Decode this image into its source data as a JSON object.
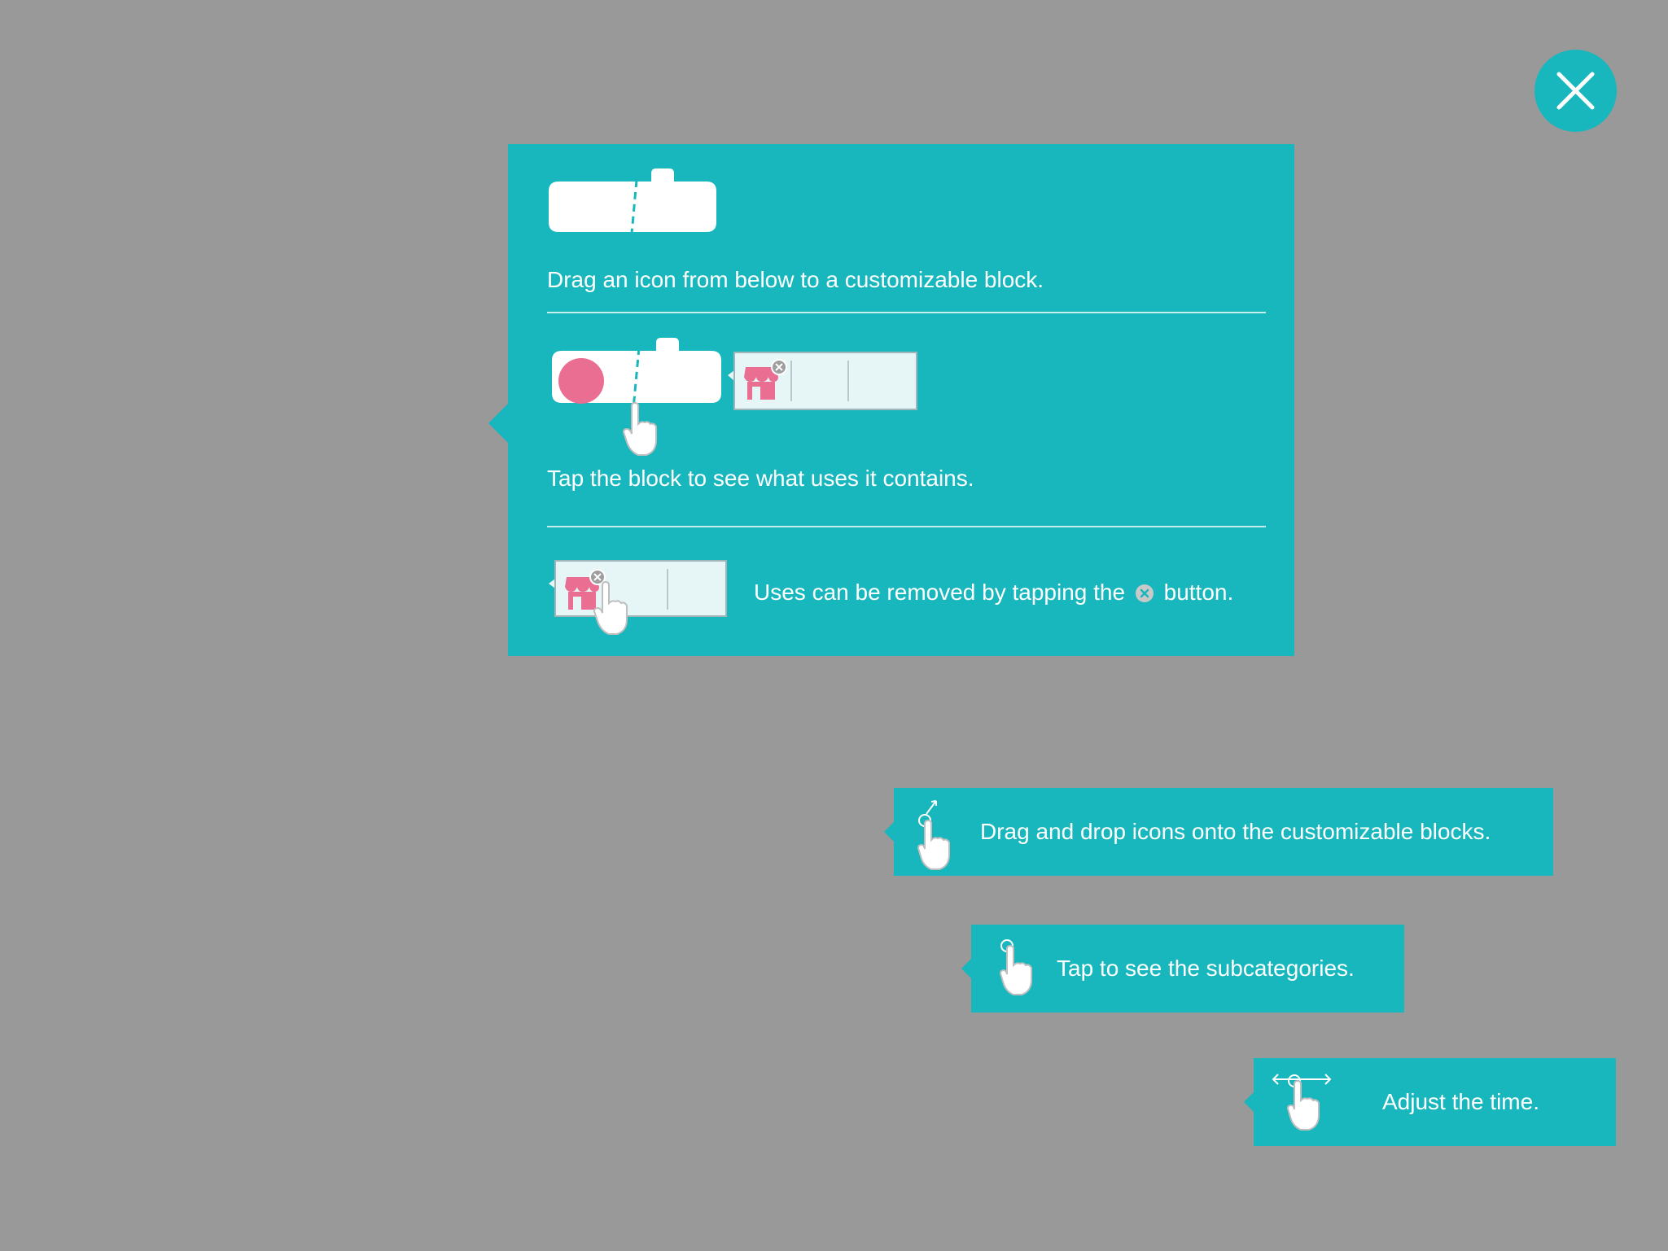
{
  "close_button": {
    "icon": "close-icon"
  },
  "help_panel": {
    "steps": [
      {
        "text": "Drag an icon from below to a customizable block."
      },
      {
        "text": "Tap the block to see what uses it contains."
      },
      {
        "text_before": "Uses can be removed by tapping the",
        "text_after": "button."
      }
    ]
  },
  "tips": {
    "drag_drop": "Drag and drop icons onto the customizable blocks.",
    "subcategories": "Tap to see the subcategories.",
    "adjust_time": "Adjust the time."
  },
  "colors": {
    "background": "#999999",
    "accent": "#18b7bd",
    "pink": "#e96e92",
    "slot_fill": "#e6f6f7"
  }
}
